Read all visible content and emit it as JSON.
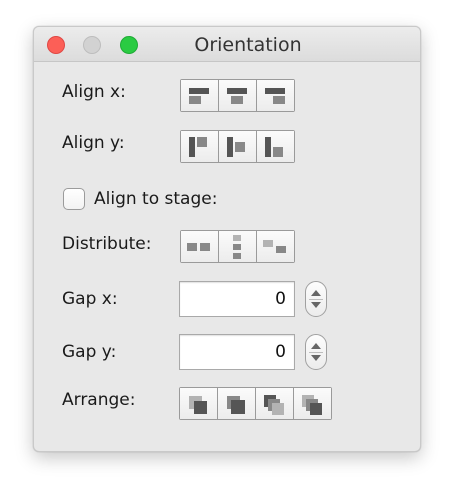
{
  "window": {
    "title": "Orientation"
  },
  "rows": {
    "align_x": {
      "label": "Align x:"
    },
    "align_y": {
      "label": "Align y:"
    },
    "align_stage": {
      "label": "Align to stage:",
      "checked": false
    },
    "distribute": {
      "label": "Distribute:"
    },
    "gap_x": {
      "label": "Gap x:",
      "value": "0"
    },
    "gap_y": {
      "label": "Gap y:",
      "value": "0"
    },
    "arrange": {
      "label": "Arrange:"
    }
  },
  "icons": {
    "align_x": [
      "align-left-icon",
      "align-center-horizontal-icon",
      "align-right-icon"
    ],
    "align_y": [
      "align-top-icon",
      "align-center-vertical-icon",
      "align-bottom-icon"
    ],
    "distribute": [
      "distribute-horizontal-icon",
      "distribute-vertical-icon",
      "distribute-stagger-icon"
    ],
    "arrange": [
      "bring-to-front-icon",
      "bring-forward-icon",
      "send-backward-icon",
      "send-to-back-icon"
    ]
  },
  "colors": {
    "close": "#fc5f57",
    "minimize": "#d2d2d2",
    "zoom": "#2acb42"
  }
}
